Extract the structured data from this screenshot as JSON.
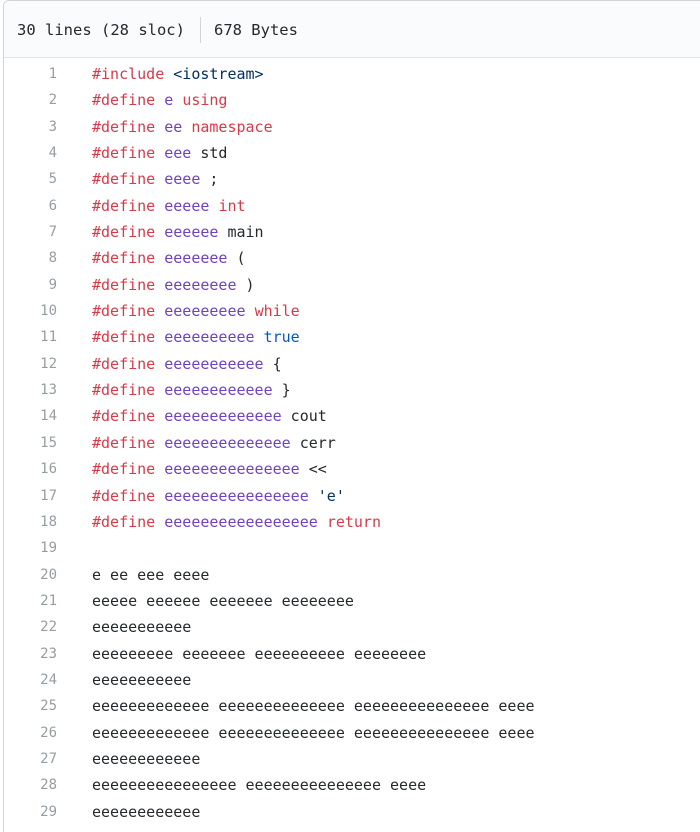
{
  "file_info": {
    "lines_label": "30 lines (28 sloc)",
    "size_label": "678 Bytes"
  },
  "colors": {
    "keyword": "#d73a49",
    "entity": "#6f42c1",
    "constant": "#005cc5",
    "string": "#032f62",
    "text": "#24292e",
    "line_number": "#959da5",
    "header_bg": "#fafbfc",
    "border": "#d1d5da"
  },
  "code_lines": [
    {
      "num": "1",
      "tokens": [
        {
          "t": "#include",
          "c": "keyword"
        },
        {
          "t": " ",
          "c": "plain"
        },
        {
          "t": "<iostream>",
          "c": "string"
        }
      ]
    },
    {
      "num": "2",
      "tokens": [
        {
          "t": "#define",
          "c": "keyword"
        },
        {
          "t": " ",
          "c": "plain"
        },
        {
          "t": "e",
          "c": "entity"
        },
        {
          "t": " ",
          "c": "plain"
        },
        {
          "t": "using",
          "c": "keyword"
        }
      ]
    },
    {
      "num": "3",
      "tokens": [
        {
          "t": "#define",
          "c": "keyword"
        },
        {
          "t": " ",
          "c": "plain"
        },
        {
          "t": "ee",
          "c": "entity"
        },
        {
          "t": " ",
          "c": "plain"
        },
        {
          "t": "namespace",
          "c": "keyword"
        }
      ]
    },
    {
      "num": "4",
      "tokens": [
        {
          "t": "#define",
          "c": "keyword"
        },
        {
          "t": " ",
          "c": "plain"
        },
        {
          "t": "eee",
          "c": "entity"
        },
        {
          "t": " std",
          "c": "plain"
        }
      ]
    },
    {
      "num": "5",
      "tokens": [
        {
          "t": "#define",
          "c": "keyword"
        },
        {
          "t": " ",
          "c": "plain"
        },
        {
          "t": "eeee",
          "c": "entity"
        },
        {
          "t": " ;",
          "c": "plain"
        }
      ]
    },
    {
      "num": "6",
      "tokens": [
        {
          "t": "#define",
          "c": "keyword"
        },
        {
          "t": " ",
          "c": "plain"
        },
        {
          "t": "eeeee",
          "c": "entity"
        },
        {
          "t": " ",
          "c": "plain"
        },
        {
          "t": "int",
          "c": "keyword"
        }
      ]
    },
    {
      "num": "7",
      "tokens": [
        {
          "t": "#define",
          "c": "keyword"
        },
        {
          "t": " ",
          "c": "plain"
        },
        {
          "t": "eeeeee",
          "c": "entity"
        },
        {
          "t": " main",
          "c": "plain"
        }
      ]
    },
    {
      "num": "8",
      "tokens": [
        {
          "t": "#define",
          "c": "keyword"
        },
        {
          "t": " ",
          "c": "plain"
        },
        {
          "t": "eeeeeee",
          "c": "entity"
        },
        {
          "t": " (",
          "c": "plain"
        }
      ]
    },
    {
      "num": "9",
      "tokens": [
        {
          "t": "#define",
          "c": "keyword"
        },
        {
          "t": " ",
          "c": "plain"
        },
        {
          "t": "eeeeeeee",
          "c": "entity"
        },
        {
          "t": " )",
          "c": "plain"
        }
      ]
    },
    {
      "num": "10",
      "tokens": [
        {
          "t": "#define",
          "c": "keyword"
        },
        {
          "t": " ",
          "c": "plain"
        },
        {
          "t": "eeeeeeeee",
          "c": "entity"
        },
        {
          "t": " ",
          "c": "plain"
        },
        {
          "t": "while",
          "c": "keyword"
        }
      ]
    },
    {
      "num": "11",
      "tokens": [
        {
          "t": "#define",
          "c": "keyword"
        },
        {
          "t": " ",
          "c": "plain"
        },
        {
          "t": "eeeeeeeeee",
          "c": "entity"
        },
        {
          "t": " ",
          "c": "plain"
        },
        {
          "t": "true",
          "c": "constant"
        }
      ]
    },
    {
      "num": "12",
      "tokens": [
        {
          "t": "#define",
          "c": "keyword"
        },
        {
          "t": " ",
          "c": "plain"
        },
        {
          "t": "eeeeeeeeeee",
          "c": "entity"
        },
        {
          "t": " {",
          "c": "plain"
        }
      ]
    },
    {
      "num": "13",
      "tokens": [
        {
          "t": "#define",
          "c": "keyword"
        },
        {
          "t": " ",
          "c": "plain"
        },
        {
          "t": "eeeeeeeeeeee",
          "c": "entity"
        },
        {
          "t": " }",
          "c": "plain"
        }
      ]
    },
    {
      "num": "14",
      "tokens": [
        {
          "t": "#define",
          "c": "keyword"
        },
        {
          "t": " ",
          "c": "plain"
        },
        {
          "t": "eeeeeeeeeeeee",
          "c": "entity"
        },
        {
          "t": " cout",
          "c": "plain"
        }
      ]
    },
    {
      "num": "15",
      "tokens": [
        {
          "t": "#define",
          "c": "keyword"
        },
        {
          "t": " ",
          "c": "plain"
        },
        {
          "t": "eeeeeeeeeeeeee",
          "c": "entity"
        },
        {
          "t": " cerr",
          "c": "plain"
        }
      ]
    },
    {
      "num": "16",
      "tokens": [
        {
          "t": "#define",
          "c": "keyword"
        },
        {
          "t": " ",
          "c": "plain"
        },
        {
          "t": "eeeeeeeeeeeeeee",
          "c": "entity"
        },
        {
          "t": " <<",
          "c": "plain"
        }
      ]
    },
    {
      "num": "17",
      "tokens": [
        {
          "t": "#define",
          "c": "keyword"
        },
        {
          "t": " ",
          "c": "plain"
        },
        {
          "t": "eeeeeeeeeeeeeeee",
          "c": "entity"
        },
        {
          "t": " ",
          "c": "plain"
        },
        {
          "t": "'e'",
          "c": "string"
        }
      ]
    },
    {
      "num": "18",
      "tokens": [
        {
          "t": "#define",
          "c": "keyword"
        },
        {
          "t": " ",
          "c": "plain"
        },
        {
          "t": "eeeeeeeeeeeeeeeee",
          "c": "entity"
        },
        {
          "t": " ",
          "c": "plain"
        },
        {
          "t": "return",
          "c": "keyword"
        }
      ]
    },
    {
      "num": "19",
      "tokens": []
    },
    {
      "num": "20",
      "tokens": [
        {
          "t": "e ee eee eeee",
          "c": "plain"
        }
      ]
    },
    {
      "num": "21",
      "tokens": [
        {
          "t": "eeeee eeeeee eeeeeee eeeeeeee",
          "c": "plain"
        }
      ]
    },
    {
      "num": "22",
      "tokens": [
        {
          "t": "eeeeeeeeeee",
          "c": "plain"
        }
      ]
    },
    {
      "num": "23",
      "tokens": [
        {
          "t": "eeeeeeeee eeeeeee eeeeeeeeee eeeeeeee",
          "c": "plain"
        }
      ]
    },
    {
      "num": "24",
      "tokens": [
        {
          "t": "eeeeeeeeeee",
          "c": "plain"
        }
      ]
    },
    {
      "num": "25",
      "tokens": [
        {
          "t": "eeeeeeeeeeeee eeeeeeeeeeeeee eeeeeeeeeeeeeee eeee",
          "c": "plain"
        }
      ]
    },
    {
      "num": "26",
      "tokens": [
        {
          "t": "eeeeeeeeeeeee eeeeeeeeeeeeee eeeeeeeeeeeeeee eeee",
          "c": "plain"
        }
      ]
    },
    {
      "num": "27",
      "tokens": [
        {
          "t": "eeeeeeeeeeee",
          "c": "plain"
        }
      ]
    },
    {
      "num": "28",
      "tokens": [
        {
          "t": "eeeeeeeeeeeeeeee eeeeeeeeeeeeeee eeee",
          "c": "plain"
        }
      ]
    },
    {
      "num": "29",
      "tokens": [
        {
          "t": "eeeeeeeeeeee",
          "c": "plain"
        }
      ]
    }
  ]
}
